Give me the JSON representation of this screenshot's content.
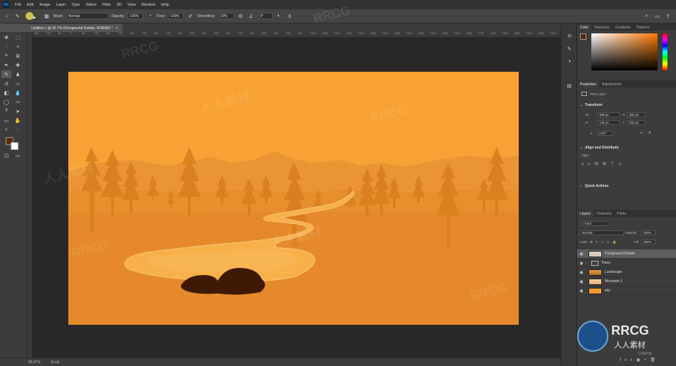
{
  "menubar": {
    "logo": "Ps",
    "items": [
      "File",
      "Edit",
      "Image",
      "Layer",
      "Type",
      "Select",
      "Filter",
      "3D",
      "View",
      "Window",
      "Help"
    ]
  },
  "options": {
    "mode_label": "Mode:",
    "mode_value": "Normal",
    "opacity_label": "Opacity:",
    "opacity_value": "100%",
    "flow_label": "Flow:",
    "flow_value": "100%",
    "smoothing_label": "Smoothing:",
    "smoothing_value": "10%",
    "angle_value": "0°"
  },
  "document": {
    "tab_title": "Untitled-1 @ 66.7% (Foreground Details, RGB/8#) *",
    "close": "×"
  },
  "ruler": {
    "top_ticks": [
      "150",
      "100",
      "50",
      "0",
      "50",
      "100",
      "150",
      "200",
      "250",
      "300",
      "350",
      "400",
      "450",
      "500",
      "550",
      "600",
      "650",
      "700",
      "750",
      "800",
      "850",
      "900",
      "950",
      "1000",
      "1050",
      "1100",
      "1150",
      "1200",
      "1250",
      "1300",
      "1350",
      "1400",
      "1450",
      "1500",
      "1550",
      "1600",
      "1650",
      "1700",
      "1750",
      "1800",
      "1850",
      "1900",
      "1950",
      "2000"
    ]
  },
  "status": {
    "zoom": "66.67%",
    "scrub": "Scroll"
  },
  "color_panel": {
    "tabs": [
      "Color",
      "Swatches",
      "Gradients",
      "Patterns"
    ]
  },
  "properties_panel": {
    "tabs": [
      "Properties",
      "Adjustments"
    ],
    "layer_type": "Pixel Layer",
    "transform_title": "Transform",
    "w_label": "W",
    "w_value": "369 px",
    "h_label": "H",
    "h_value": "136 px",
    "x_label": "X",
    "x_value": "482 px",
    "y_label": "Y",
    "y_value": "832 px",
    "angle_value": "0.00°",
    "align_title": "Align and Distribute",
    "align_label": "Align:",
    "quick_actions_title": "Quick Actions"
  },
  "layers_panel": {
    "tabs": [
      "Layers",
      "Channels",
      "Paths"
    ],
    "kind_label": "Kind",
    "blend_mode": "Normal",
    "opacity_label": "Opacity:",
    "opacity_value": "100%",
    "lock_label": "Lock:",
    "fill_label": "Fill:",
    "fill_value": "100%",
    "layers": [
      {
        "name": "Foreground Details",
        "thumb": "#d9c9b8",
        "selected": true
      },
      {
        "name": "Trees",
        "thumb": "folder",
        "selected": false
      },
      {
        "name": "Landscape",
        "thumb": "#e8a04a",
        "selected": false
      },
      {
        "name": "Mountain 1",
        "thumb": "#e9b070",
        "selected": false
      },
      {
        "name": "sky",
        "thumb": "#f29a28",
        "selected": false
      }
    ]
  },
  "colors": {
    "foreground": "#5a2a0a",
    "background": "#ffffff",
    "accent": "#f5a136"
  },
  "watermarks": [
    "RRCG",
    "人人素材"
  ],
  "brand_logo_text": "RRCG",
  "brand_logo_sub": "人人素材",
  "udemy": "Udemy"
}
